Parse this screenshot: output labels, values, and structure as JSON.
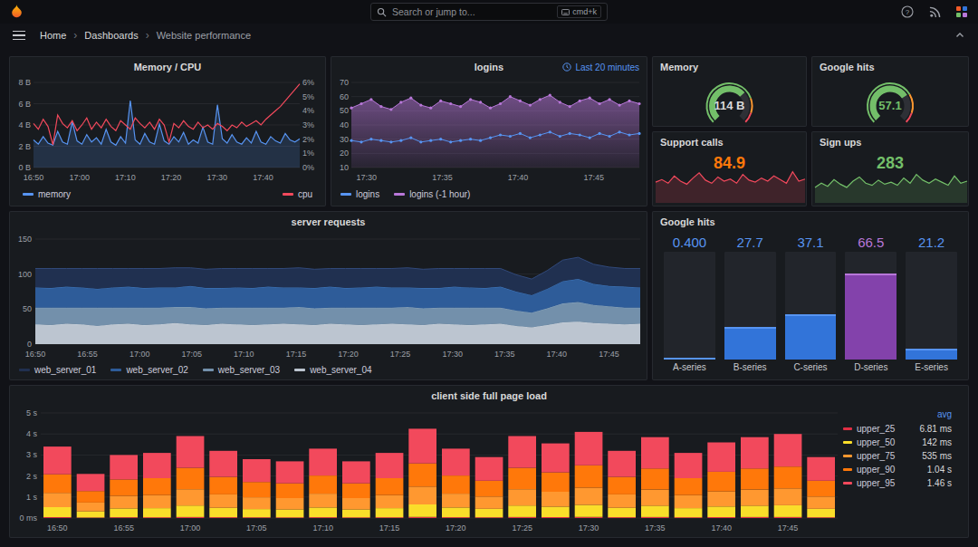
{
  "colors": {
    "blue": "#5794f2",
    "red": "#f2495c",
    "purple": "#b877d9",
    "green": "#73bf69",
    "orange": "#ff780a",
    "yellow": "#fade2a",
    "link": "#5794f2"
  },
  "navbar": {
    "search_placeholder": "Search or jump to...",
    "shortcut_badge": "cmd+k"
  },
  "breadcrumb": {
    "items": [
      "Home",
      "Dashboards",
      "Website performance"
    ]
  },
  "panels": {
    "memory_cpu": {
      "title": "Memory / CPU",
      "y_left_ticks": [
        "0 B",
        "2 B",
        "4 B",
        "6 B",
        "8 B"
      ],
      "y_right_ticks": [
        "0%",
        "1%",
        "2%",
        "3%",
        "4%",
        "5%",
        "6%"
      ],
      "x_ticks": [
        "16:50",
        "17:00",
        "17:10",
        "17:20",
        "17:30",
        "17:40"
      ],
      "legend": [
        {
          "label": "memory",
          "color": "#5794f2"
        },
        {
          "label": "cpu",
          "color": "#f2495c"
        }
      ],
      "memory": [
        2.6,
        2.2,
        2.9,
        2.3,
        2.1,
        3.4,
        2.4,
        2.2,
        4.3,
        2.5,
        2.2,
        3.1,
        2.4,
        2.8,
        2.2,
        3.6,
        2.4,
        2.1,
        2.9,
        2.3,
        6.3,
        2.6,
        2.2,
        3.2,
        2.4,
        2.2,
        4.1,
        2.5,
        2.2,
        2.9,
        2.4,
        3.3,
        2.2,
        2.6,
        2.3,
        3.8,
        2.4,
        2.2,
        5.9,
        2.7,
        2.3,
        3.1,
        2.4,
        2.2,
        2.8,
        2.3,
        3.4,
        2.4,
        2.2,
        2.9,
        2.5,
        2.3,
        3.2,
        2.6,
        2.4,
        2.7
      ],
      "cpu": [
        3.1,
        2.7,
        3.4,
        2.9,
        1.6,
        3.7,
        3.1,
        2.8,
        3.3,
        2.6,
        3.0,
        3.5,
        2.7,
        3.2,
        2.8,
        3.4,
        2.9,
        2.6,
        3.3,
        3.0,
        2.7,
        3.5,
        3.1,
        2.8,
        3.2,
        2.7,
        3.4,
        3.0,
        1.8,
        3.1,
        2.8,
        3.3,
        2.9,
        2.7,
        3.2,
        2.8,
        3.0,
        2.7,
        3.1,
        2.9,
        2.6,
        3.0,
        2.8,
        3.2,
        2.9,
        3.1,
        3.3,
        3.0,
        3.4,
        3.7,
        4.0,
        4.3,
        4.7,
        5.1,
        5.5,
        5.9
      ]
    },
    "logins": {
      "title": "logins",
      "time_range_label": "Last 20 minutes",
      "y_ticks": [
        "10",
        "20",
        "30",
        "40",
        "50",
        "60",
        "70"
      ],
      "x_ticks": [
        "17:30",
        "17:35",
        "17:40",
        "17:45"
      ],
      "legend": [
        {
          "label": "logins",
          "color": "#5794f2"
        },
        {
          "label": "logins (-1 hour)",
          "color": "#b877d9"
        }
      ],
      "logins": [
        29,
        28,
        30,
        29,
        28,
        29,
        31,
        28,
        29,
        30,
        28,
        29,
        30,
        29,
        31,
        33,
        32,
        34,
        31,
        33,
        35,
        32,
        34,
        33,
        31,
        34,
        32,
        35,
        33,
        34
      ],
      "logins_prev": [
        52,
        55,
        58,
        53,
        51,
        56,
        59,
        54,
        52,
        57,
        55,
        53,
        58,
        56,
        52,
        55,
        60,
        57,
        54,
        58,
        61,
        56,
        53,
        57,
        59,
        55,
        58,
        54,
        57,
        55
      ]
    },
    "memory_gauge": {
      "title": "Memory",
      "value": "114 B",
      "value_color": "#d8d9da",
      "fill": 0.68,
      "fill_color": "#73bf69",
      "ring": [
        {
          "from": 0,
          "to": 0.76,
          "color": "#73bf69"
        },
        {
          "from": 0.76,
          "to": 0.9,
          "color": "#ff9830"
        },
        {
          "from": 0.9,
          "to": 1,
          "color": "#f2495c"
        }
      ]
    },
    "google_hits_gauge": {
      "title": "Google hits",
      "value": "57.1",
      "value_color": "#73bf69",
      "fill": 0.71,
      "fill_color": "#73bf69",
      "ring": [
        {
          "from": 0,
          "to": 0.72,
          "color": "#73bf69"
        },
        {
          "from": 0.72,
          "to": 0.9,
          "color": "#ff9830"
        },
        {
          "from": 0.9,
          "to": 1,
          "color": "#f2495c"
        }
      ]
    },
    "support_calls": {
      "title": "Support calls",
      "value": "84.9",
      "value_color": "#ff780a",
      "line_color": "#f2495c",
      "fill_color": "rgba(242,73,92,0.18)",
      "spark": [
        40,
        45,
        38,
        52,
        42,
        36,
        48,
        58,
        44,
        38,
        50,
        42,
        46,
        38,
        55,
        44,
        40,
        48,
        42,
        52,
        45,
        38,
        60,
        42,
        46
      ]
    },
    "sign_ups": {
      "title": "Sign ups",
      "value": "283",
      "value_color": "#73bf69",
      "line_color": "#73bf69",
      "fill_color": "rgba(115,191,105,0.18)",
      "spark": [
        30,
        38,
        32,
        45,
        36,
        30,
        42,
        50,
        38,
        34,
        44,
        36,
        40,
        34,
        48,
        38,
        55,
        44,
        38,
        46,
        40,
        34,
        52,
        38,
        42
      ]
    },
    "server_requests": {
      "title": "server requests",
      "y_ticks": [
        "0",
        "50",
        "100",
        "150"
      ],
      "x_ticks": [
        "16:50",
        "16:55",
        "17:00",
        "17:05",
        "17:10",
        "17:15",
        "17:20",
        "17:25",
        "17:30",
        "17:35",
        "17:40",
        "17:45"
      ],
      "series": [
        {
          "name": "web_server_01",
          "color": "#203050",
          "edge": "#31497a",
          "values": [
            27,
            28,
            26,
            27,
            29,
            27,
            26,
            28,
            27,
            28,
            26,
            27,
            28,
            27,
            28,
            26,
            27,
            28,
            27,
            26,
            28,
            27,
            26,
            27,
            28,
            27,
            28,
            26,
            27,
            28,
            26,
            24,
            23,
            26,
            30,
            31,
            28,
            27,
            26,
            27
          ]
        },
        {
          "name": "web_server_02",
          "color": "#2e5c99",
          "edge": "#417ac0",
          "values": [
            29,
            28,
            30,
            29,
            27,
            29,
            30,
            28,
            29,
            28,
            30,
            29,
            28,
            29,
            28,
            30,
            29,
            28,
            29,
            30,
            28,
            29,
            30,
            29,
            28,
            29,
            28,
            30,
            29,
            28,
            30,
            27,
            25,
            28,
            32,
            33,
            30,
            29,
            30,
            29
          ]
        },
        {
          "name": "web_server_03",
          "color": "#7390ab",
          "edge": "#8ba6be",
          "values": [
            24,
            25,
            23,
            24,
            26,
            24,
            23,
            25,
            24,
            23,
            25,
            24,
            23,
            24,
            25,
            24,
            23,
            25,
            24,
            23,
            24,
            25,
            24,
            23,
            25,
            24,
            23,
            24,
            25,
            24,
            23,
            22,
            21,
            24,
            27,
            28,
            26,
            25,
            24,
            23
          ]
        },
        {
          "name": "web_server_04",
          "color": "#bcc5d0",
          "edge": "#cfd6de",
          "values": [
            28,
            27,
            29,
            28,
            26,
            28,
            29,
            27,
            28,
            30,
            28,
            27,
            29,
            28,
            27,
            28,
            29,
            28,
            27,
            29,
            28,
            27,
            28,
            29,
            28,
            27,
            29,
            28,
            27,
            28,
            29,
            26,
            24,
            27,
            31,
            32,
            30,
            29,
            28,
            29
          ]
        }
      ]
    },
    "google_hits_bars": {
      "title": "Google hits",
      "bars": [
        {
          "label": "A-series",
          "value": "0.400",
          "value_color": "#5794f2",
          "fill": 0.015,
          "color": "#3274d9",
          "edge": "#5794f2"
        },
        {
          "label": "B-series",
          "value": "27.7",
          "value_color": "#5794f2",
          "fill": 0.3,
          "color": "#3274d9",
          "edge": "#5794f2"
        },
        {
          "label": "C-series",
          "value": "37.1",
          "value_color": "#5794f2",
          "fill": 0.42,
          "color": "#3274d9",
          "edge": "#5794f2"
        },
        {
          "label": "D-series",
          "value": "66.5",
          "value_color": "#b877d9",
          "fill": 0.8,
          "color": "#8342ab",
          "edge": "#b877d9"
        },
        {
          "label": "E-series",
          "value": "21.2",
          "value_color": "#5794f2",
          "fill": 0.1,
          "color": "#3274d9",
          "edge": "#5794f2"
        }
      ]
    },
    "page_load": {
      "title": "client side full page load",
      "y_ticks": [
        "0 ms",
        "1 s",
        "2 s",
        "3 s",
        "4 s",
        "5 s"
      ],
      "x_ticks": [
        "16:50",
        "16:55",
        "17:00",
        "17:05",
        "17:10",
        "17:15",
        "17:20",
        "17:25",
        "17:30",
        "17:35",
        "17:40",
        "17:45"
      ],
      "legend_header": "avg",
      "series": [
        {
          "name": "upper_25",
          "avg": "6.81 ms",
          "color": "#e02f44",
          "frac": 0.012
        },
        {
          "name": "upper_50",
          "avg": "142 ms",
          "color": "#fade2a",
          "frac": 0.14
        },
        {
          "name": "upper_75",
          "avg": "535 ms",
          "color": "#ff9830",
          "frac": 0.2
        },
        {
          "name": "upper_90",
          "avg": "1.04 s",
          "color": "#ff780a",
          "frac": 0.26
        },
        {
          "name": "upper_95",
          "avg": "1.46 s",
          "color": "#f2495c",
          "frac": 0.388
        }
      ],
      "totals": [
        3.4,
        2.1,
        3.0,
        3.1,
        3.9,
        3.2,
        2.8,
        2.7,
        3.3,
        2.7,
        3.1,
        4.25,
        3.3,
        2.9,
        3.9,
        3.55,
        4.1,
        3.2,
        3.85,
        3.1,
        3.6,
        3.85,
        4.0,
        2.9
      ]
    }
  }
}
